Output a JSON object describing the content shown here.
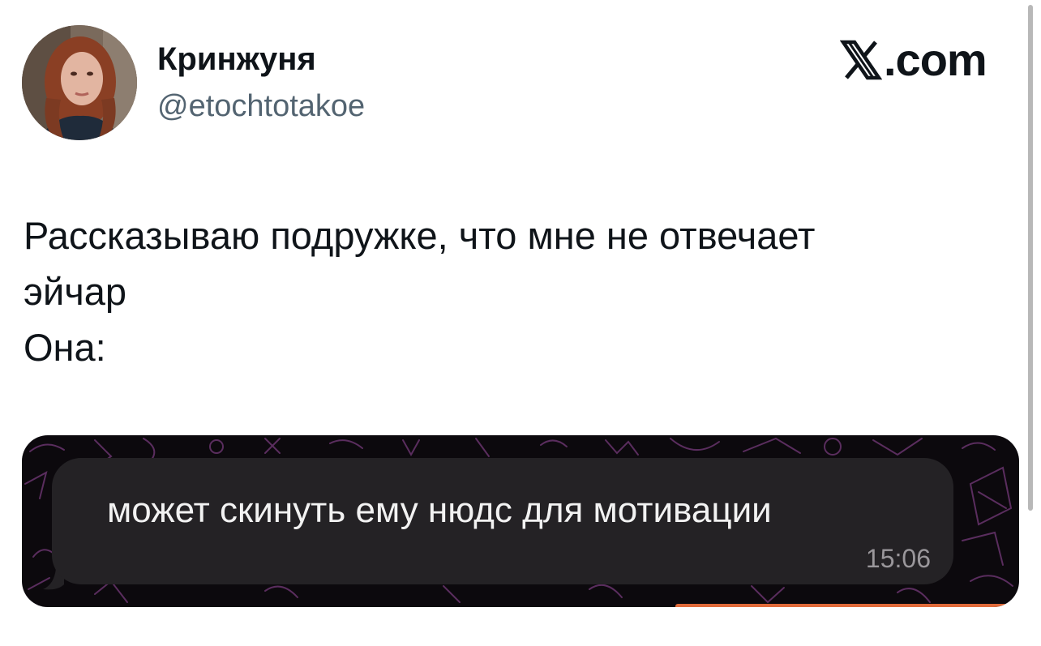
{
  "author": {
    "display_name": "Кринжуня",
    "handle": "@etochtotakoe"
  },
  "brand": {
    "icon": "x-logo-icon",
    "label": ".com"
  },
  "tweet": {
    "lines": [
      "Рассказываю подружке, что мне не отвечает",
      "эйчар",
      "Она:"
    ]
  },
  "media": {
    "message": {
      "text": "может скинуть ему нюдс для мотивации",
      "time": "15:06"
    }
  },
  "colors": {
    "text_primary": "#0f1419",
    "text_secondary": "#536471",
    "chat_background": "#0c090d",
    "bubble": "#242225",
    "doodle": "#5a2d5e"
  }
}
